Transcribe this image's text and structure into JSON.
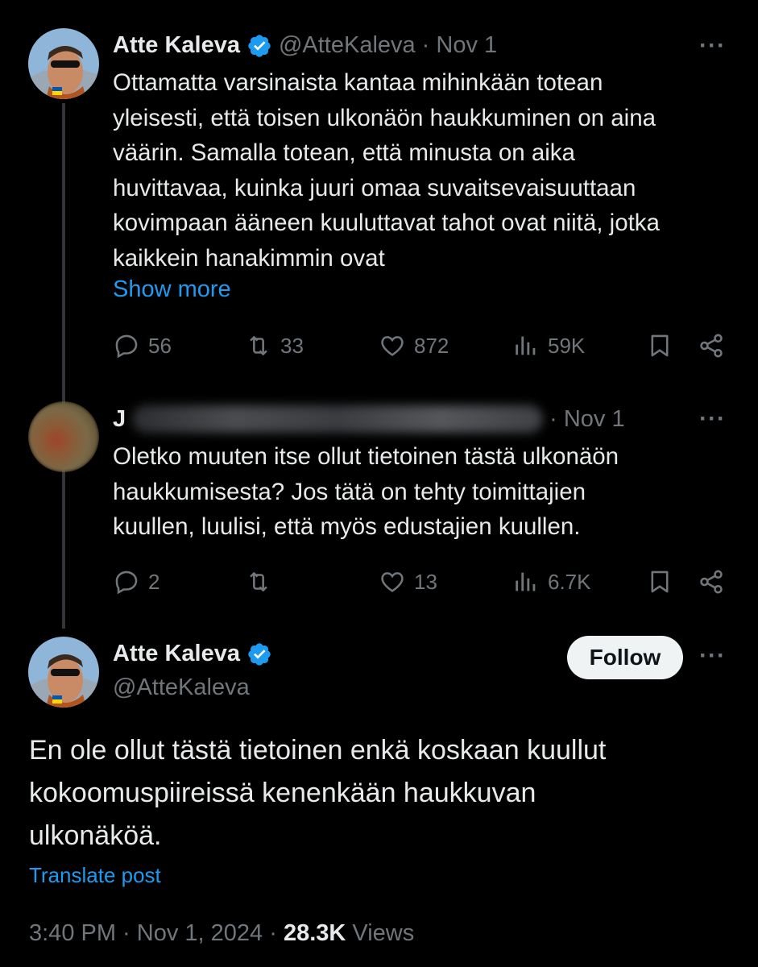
{
  "tweet1": {
    "name": "Atte Kaleva",
    "handle": "@AtteKaleva",
    "date": "· Nov 1",
    "text": "Ottamatta varsinaista kantaa mihinkään totean\nyleisesti, että toisen ulkonäön haukkuminen on aina\nväärin. Samalla totean, että minusta on aika\nhuvittavaa, kuinka juuri omaa suvaitsevaisuuttaan\nkovimpaan ääneen kuuluttavat tahot ovat niitä, jotka\nkaikkein hanakimmin ovat",
    "show_more": "Show more",
    "replies": "56",
    "retweets": "33",
    "likes": "872",
    "views": "59K"
  },
  "tweet2": {
    "name_initial": "J",
    "date": "· Nov 1",
    "text": "Oletko muuten itse ollut tietoinen tästä ulkonäön\nhaukkumisesta? Jos tätä on tehty toimittajien\nkuullen, luulisi, että myös edustajien kuullen.",
    "replies": "2",
    "likes": "13",
    "views": "6.7K"
  },
  "main_tweet": {
    "name": "Atte Kaleva",
    "handle": "@AtteKaleva",
    "follow_label": "Follow",
    "text": "En ole ollut tästä tietoinen enkä koskaan kuullut\nkokoomuspiireissä kenenkään haukkuvan\nulkonäköä.",
    "translate": "Translate post",
    "timestamp": "3:40 PM · Nov 1, 2024 · ",
    "views_count": "28.3K",
    "views_label": " Views"
  },
  "colors": {
    "background": "#000000",
    "text": "#e7e9ea",
    "muted": "#71767b",
    "link": "#1d9bf0",
    "verified": "#1d9bf0"
  },
  "icons": [
    "reply-icon",
    "retweet-icon",
    "like-icon",
    "views-icon",
    "bookmark-icon",
    "share-icon",
    "more-icon",
    "verified-icon"
  ]
}
